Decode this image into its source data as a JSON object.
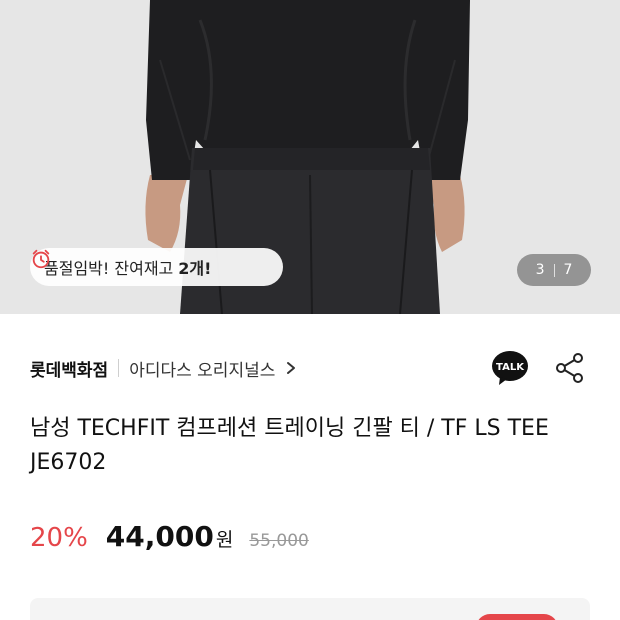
{
  "product_image": {
    "stock_notice": {
      "icon": "alarm-clock-icon",
      "text": "품절임박! 잔여재고",
      "count": "2개!"
    },
    "pager": {
      "current": "3",
      "total": "7"
    }
  },
  "brand_row": {
    "store": "롯데백화점",
    "brand": "아디다스 오리지널스",
    "talk_label": "TALK",
    "share_icon": "share-icon"
  },
  "product": {
    "title": "남성 TECHFIT 컴프레션 트레이닝 긴팔 티 / TF LS TEE JE6702",
    "discount": "20%",
    "price": "44,000",
    "currency": "원",
    "original_price": "55,000"
  },
  "colors": {
    "accent_red": "#e5464a",
    "strike_gray": "#999999"
  }
}
